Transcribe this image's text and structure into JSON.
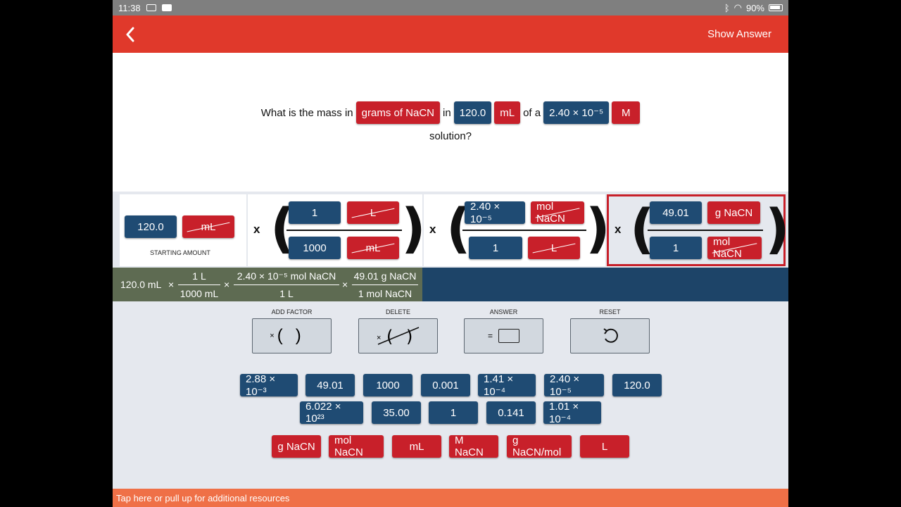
{
  "status": {
    "time": "11:38",
    "battery": "90%"
  },
  "header": {
    "show_answer": "Show Answer"
  },
  "question": {
    "prefix": "What is the mass in",
    "chip1": "grams of NaCN",
    "word_in": "in",
    "chip2": "120.0",
    "chip3": "mL",
    "word_of": "of a",
    "chip4": "2.40 × 10⁻⁵",
    "chip5": "M",
    "line2": "solution?"
  },
  "workspace": {
    "starting_amount": {
      "value": "120.0",
      "unit": "mL",
      "label": "STARTING AMOUNT"
    },
    "times": "x",
    "factor1": {
      "num_value": "1",
      "num_unit": "L",
      "den_value": "1000",
      "den_unit": "mL"
    },
    "factor2": {
      "num_value": "2.40 × 10⁻⁵",
      "num_unit": "mol NaCN",
      "den_value": "1",
      "den_unit": "L"
    },
    "factor3": {
      "num_value": "49.01",
      "num_unit": "g NaCN",
      "den_value": "1",
      "den_unit": "mol NaCN"
    }
  },
  "summary": {
    "start": "120.0 mL",
    "times": "×",
    "f1_num": "1 L",
    "f1_den": "1000 mL",
    "f2_num": "2.40 × 10⁻⁵ mol NaCN",
    "f2_den": "1 L",
    "f3_num": "49.01 g NaCN",
    "f3_den": "1 mol NaCN"
  },
  "tools": {
    "add_factor": "ADD FACTOR",
    "delete": "DELETE",
    "answer": "ANSWER",
    "reset": "RESET",
    "add_glyph": "× (   )",
    "answer_glyph": "="
  },
  "number_bank": {
    "row1": [
      "2.88 × 10⁻³",
      "49.01",
      "1000",
      "0.001",
      "1.41 × 10⁻⁴",
      "2.40 × 10⁻⁵",
      "120.0"
    ],
    "row2": [
      "6.022 × 10²³",
      "35.00",
      "1",
      "0.141",
      "1.01 × 10⁻⁴"
    ]
  },
  "unit_bank": [
    "g NaCN",
    "mol NaCN",
    "mL",
    "M NaCN",
    "g NaCN/mol",
    "L"
  ],
  "footer": {
    "text": "Tap here or pull up for additional resources"
  },
  "colors": {
    "accent_red": "#e0392b",
    "chip_blue": "#1f4b73",
    "chip_red": "#c8202a",
    "footer": "#ef7047"
  },
  "icons": [
    "back-chevron-icon",
    "mail-icon",
    "camera-icon",
    "bluetooth-icon",
    "wifi-icon",
    "battery-icon",
    "undo-icon"
  ]
}
